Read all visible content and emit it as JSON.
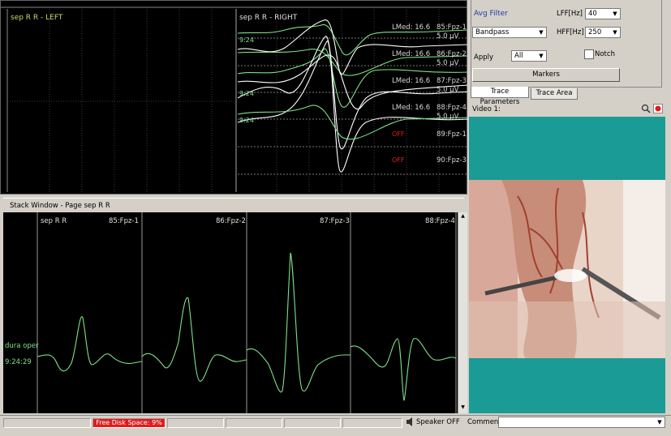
{
  "top_panel": {
    "left_title": "sep R R - LEFT",
    "right_title": "sep R R - RIGHT",
    "time_labels": [
      "9:24",
      "9:24",
      "9:24"
    ],
    "channels": [
      {
        "lmed": "LMed: 16.6",
        "name": "85:Fpz-1",
        "amp": "5.0 µV"
      },
      {
        "lmed": "LMed: 16.6",
        "name": "86:Fpz-2",
        "amp": "5.0 µV"
      },
      {
        "lmed": "LMed: 16.6",
        "name": "87:Fpz-3",
        "amp": "5.0 µV"
      },
      {
        "lmed": "LMed: 16.6",
        "name": "88:Fpz-4",
        "amp": "5.0 µV"
      }
    ],
    "off_channels": [
      {
        "status": "OFF",
        "name": "89:Fpz-1"
      },
      {
        "status": "OFF",
        "name": "90:Fpz-3"
      }
    ]
  },
  "params": {
    "avg_filter_label": "Avg Filter",
    "filter_type": "Bandpass",
    "lff_label": "LFF[Hz]",
    "lff_value": "40",
    "hff_label": "HFF[Hz]",
    "hff_value": "250",
    "apply_label": "Apply",
    "apply_value": "All",
    "notch_label": "Notch",
    "markers_button": "Markers",
    "tabs": [
      "Trace Parameters",
      "Trace Area"
    ]
  },
  "stack": {
    "title": "Stack Window - Page sep R R",
    "page_label": "sep R R",
    "channels": [
      "85:Fpz-1",
      "86:Fpz-2",
      "87:Fpz-3",
      "88:Fpz-4"
    ],
    "side_label": "dura oper",
    "side_time": "9:24:29"
  },
  "video": {
    "title": "Video 1:",
    "search_icon": "magnifier-icon",
    "record_icon": "record-icon"
  },
  "status": {
    "disk_space": "Free Disk Space: 9%",
    "speaker": "Speaker OFF",
    "comment_label": "Comment:"
  },
  "colors": {
    "trace_green": "#7fe08a",
    "trace_white": "#ffffff",
    "off_red": "#e02020",
    "video_teal": "#1a9b95",
    "disk_red": "#e11b1b"
  }
}
